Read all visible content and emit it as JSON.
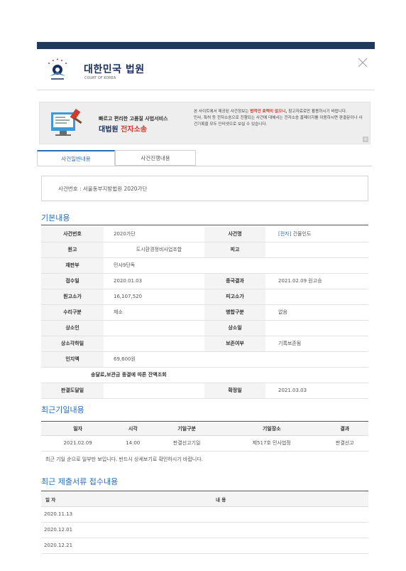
{
  "header": {
    "title": "대한민국 법원",
    "subtitle": "COURT OF KOREA",
    "emblem_text": "대 한 민 국 법 원"
  },
  "banner": {
    "line1": "빠르고 편리한 고품질 사법서비스",
    "line2_main": "대법원",
    "line2_red": "전자소송",
    "notice_pre": "본 사이트에서 제공된 사건정보는 ",
    "notice_hl": "법적인 효력이 없으니,",
    "notice_post": " 참고자료로만 활용하시기 바랍니다.",
    "notice_line2": "민사, 특허 등 전자소송으로 진행되는 사건에 대해서는 전자소송 홈페이지를 이용하시면 판결문이나 사건기록을 모두 인터넷으로 보실 수 있습니다.",
    "plus": "+"
  },
  "tabs": [
    {
      "label": "사건일반내용"
    },
    {
      "label": "사건진행내용"
    }
  ],
  "case_number": "사건번호 : 서울동부지방법원 2020가단",
  "basic": {
    "title": "기본내용",
    "rows": [
      {
        "l1": "사건번호",
        "v1": "2020가단",
        "l2": "사건명",
        "v2_tag": "[전자]",
        "v2": " 건물인도"
      },
      {
        "l1": "원고",
        "v1": "도시환경정비사업조합",
        "l2": "피고",
        "v2_tag": "",
        "v2": ""
      },
      {
        "l1": "재판부",
        "v1": "민사9단독",
        "l2": "",
        "v2_tag": "",
        "v2": ""
      },
      {
        "l1": "접수일",
        "v1": "2020.01.03",
        "l2": "종국결과",
        "v2_tag": "",
        "v2": "2021.02.09 원고승"
      },
      {
        "l1": "원고소가",
        "v1": "16,107,520",
        "l2": "피고소가",
        "v2_tag": "",
        "v2": ""
      },
      {
        "l1": "수리구분",
        "v1": "제소",
        "l2": "병합구분",
        "v2_tag": "",
        "v2": "없음"
      },
      {
        "l1": "상소인",
        "v1": "",
        "l2": "상소일",
        "v2_tag": "",
        "v2": ""
      },
      {
        "l1": "상소각하일",
        "v1": "",
        "l2": "보존여부",
        "v2_tag": "",
        "v2": "기록보존됨"
      },
      {
        "l1": "인지액",
        "v1": "69,600원",
        "l2": "",
        "v2_tag": "",
        "v2": ""
      }
    ],
    "deposit_label": "송달료,보관금 종결에 따른 잔액조회",
    "last_row": {
      "l1": "판결도달일",
      "v1": "",
      "l2": "확정일",
      "v2": "2021.03.03"
    }
  },
  "hearing": {
    "title": "최근기일내용",
    "headers": [
      "일자",
      "시각",
      "기일구분",
      "기일장소",
      "결과"
    ],
    "rows": [
      [
        "2021.02.09",
        "14:00",
        "판결선고기일",
        "제517호 민사법정",
        "판결선고"
      ]
    ],
    "notice": "최근 기일 순으로 일부만 보입니다. 반드시 상세보기로 확인하시기 바랍니다."
  },
  "documents": {
    "title": "최근 제출서류 접수내용",
    "headers": [
      "일 자",
      "내 용"
    ],
    "rows": [
      [
        "2020.11.13",
        ""
      ],
      [
        "2020.12.01",
        ""
      ],
      [
        "2020.12.21",
        ""
      ]
    ]
  },
  "colors": {
    "topbar": "#1e3a5c",
    "accent": "#2a6db5",
    "highlight_red": "#d23a2c"
  }
}
